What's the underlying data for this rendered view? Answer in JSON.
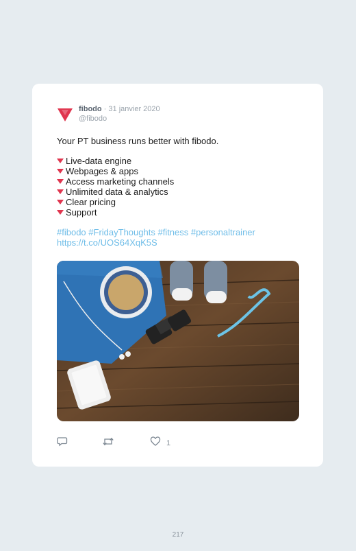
{
  "tweet": {
    "author_name": "fibodo",
    "separator": "·",
    "date": "31 janvier 2020",
    "handle": "@fibodo",
    "intro": "Your PT business runs better with fibodo.",
    "bullets": [
      "Live-data engine",
      "Webpages & apps",
      "Access marketing channels",
      "Unlimited data & analytics",
      "Clear pricing",
      "Support"
    ],
    "hashtags": [
      "#fibodo",
      "#FridayThoughts",
      "#fitness",
      "#personaltrainer"
    ],
    "link": "https://t.co/UOS64XqK5S",
    "like_count": "1"
  },
  "page_number": "217",
  "colors": {
    "background": "#e6ecf0",
    "card": "#ffffff",
    "brand_red": "#e0364f",
    "hashtag": "#6fbde8"
  },
  "icons": [
    "fibodo-logo-icon",
    "reply-icon",
    "retweet-icon",
    "like-icon"
  ]
}
